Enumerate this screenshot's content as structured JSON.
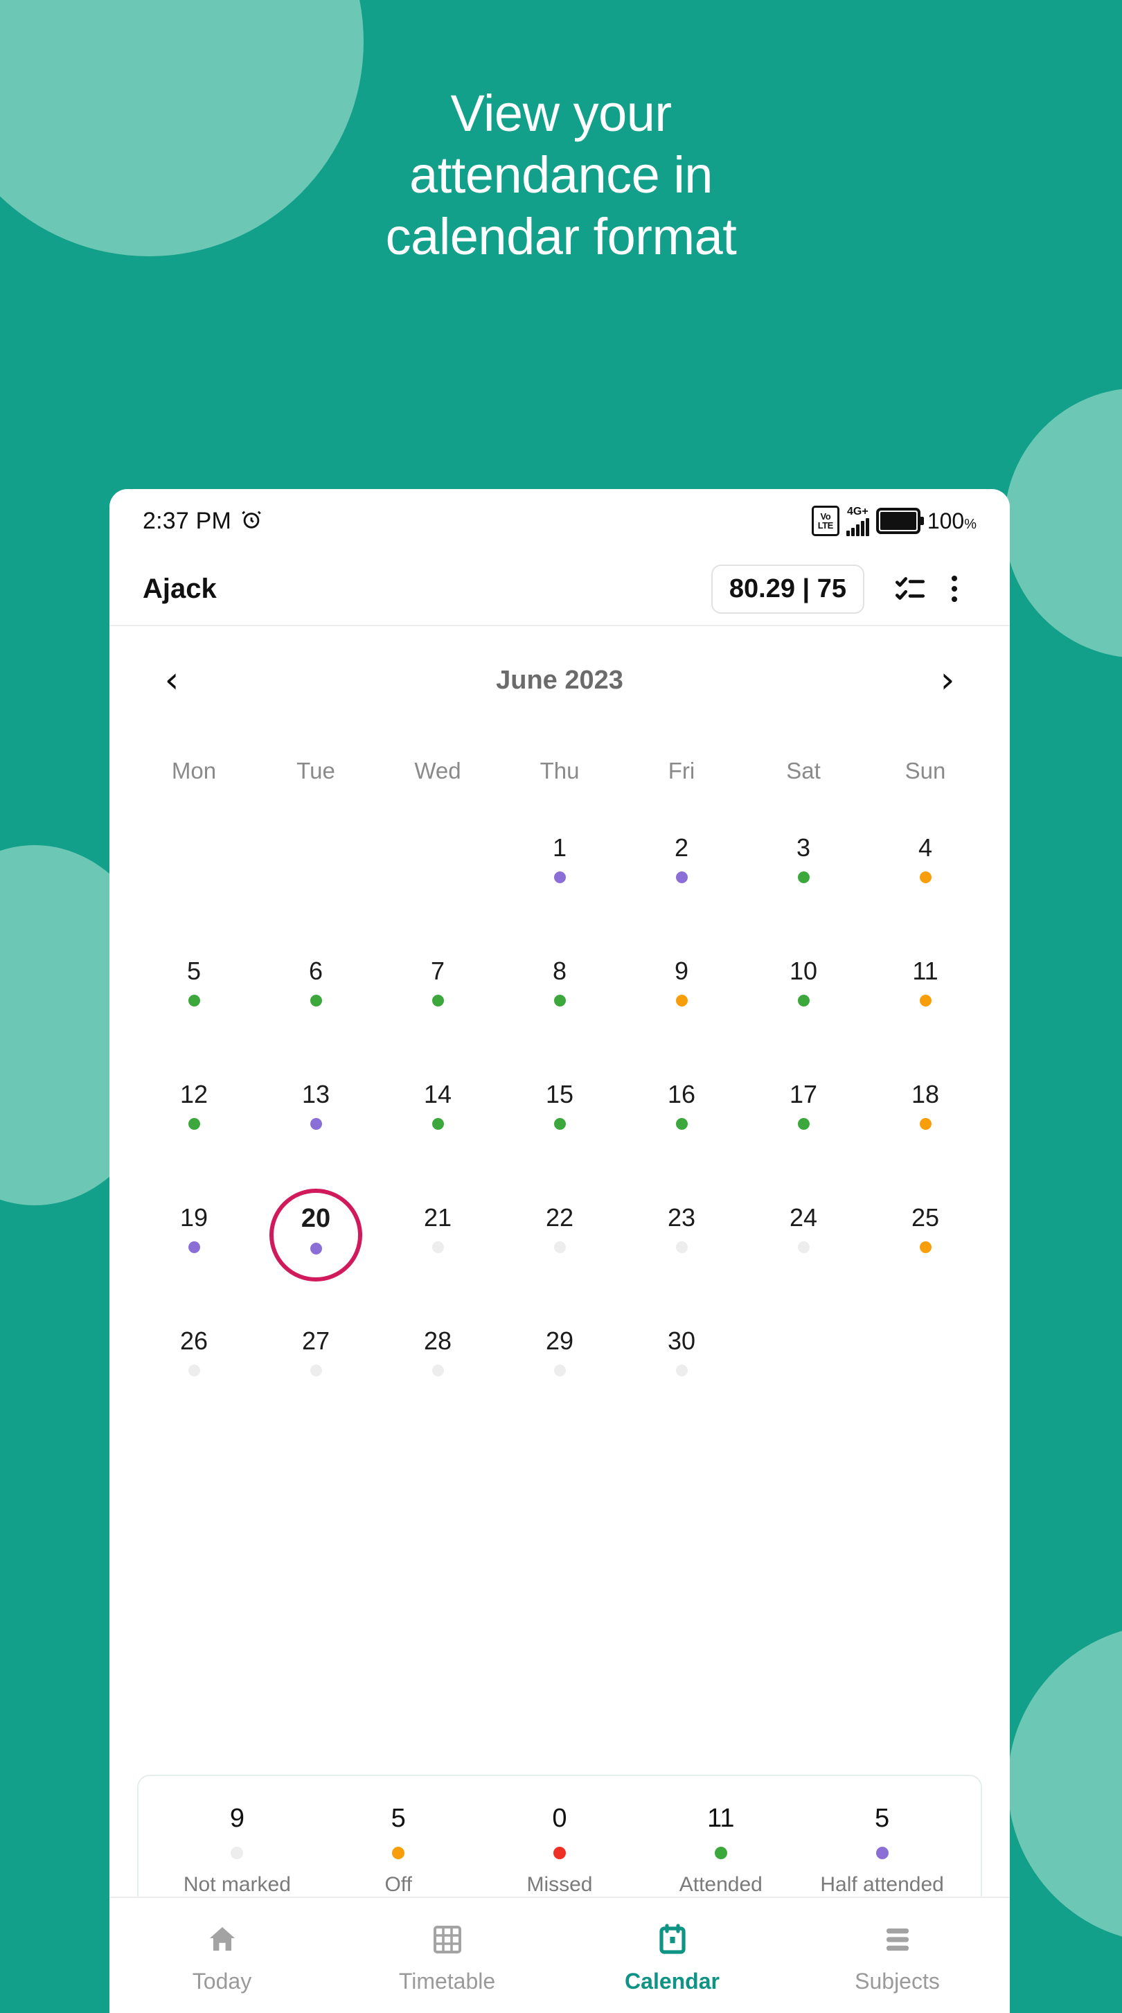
{
  "promo": {
    "headline_lines": [
      "View your",
      "attendance in",
      "calendar format"
    ],
    "background_color": "#12A08A",
    "accent_circle_color": "#6CC8B5"
  },
  "statusbar": {
    "time": "2:37 PM",
    "alarm_icon": "alarm-clock-icon",
    "volte_top": "Vo",
    "volte_bottom": "LTE",
    "network": "4G+",
    "battery_percent": "100",
    "percent_symbol": "%"
  },
  "appbar": {
    "title": "Ajack",
    "percentage_badge": "80.29 | 75",
    "checklist_icon": "checklist-icon",
    "overflow_icon": "more-vertical-icon"
  },
  "calendar": {
    "prev_label": "‹",
    "next_label": "›",
    "month_label": "June 2023",
    "weekdays": [
      "Mon",
      "Tue",
      "Wed",
      "Thu",
      "Fri",
      "Sat",
      "Sun"
    ],
    "leading_blanks": 3,
    "selected_day": "20",
    "selected_ring_color": "#D01A5B",
    "status_colors": {
      "attended": "#3CA83C",
      "half": "#8B6FD6",
      "off": "#F79E0A",
      "missed": "#EE3124",
      "not_marked": "#EDEDED"
    },
    "days": [
      {
        "num": "1",
        "status": "half"
      },
      {
        "num": "2",
        "status": "half"
      },
      {
        "num": "3",
        "status": "attended"
      },
      {
        "num": "4",
        "status": "off"
      },
      {
        "num": "5",
        "status": "attended"
      },
      {
        "num": "6",
        "status": "attended"
      },
      {
        "num": "7",
        "status": "attended"
      },
      {
        "num": "8",
        "status": "attended"
      },
      {
        "num": "9",
        "status": "off"
      },
      {
        "num": "10",
        "status": "attended"
      },
      {
        "num": "11",
        "status": "off"
      },
      {
        "num": "12",
        "status": "attended"
      },
      {
        "num": "13",
        "status": "half"
      },
      {
        "num": "14",
        "status": "attended"
      },
      {
        "num": "15",
        "status": "attended"
      },
      {
        "num": "16",
        "status": "attended"
      },
      {
        "num": "17",
        "status": "attended"
      },
      {
        "num": "18",
        "status": "off"
      },
      {
        "num": "19",
        "status": "half"
      },
      {
        "num": "20",
        "status": "half"
      },
      {
        "num": "21",
        "status": "not_marked"
      },
      {
        "num": "22",
        "status": "not_marked"
      },
      {
        "num": "23",
        "status": "not_marked"
      },
      {
        "num": "24",
        "status": "not_marked"
      },
      {
        "num": "25",
        "status": "off"
      },
      {
        "num": "26",
        "status": "not_marked"
      },
      {
        "num": "27",
        "status": "not_marked"
      },
      {
        "num": "28",
        "status": "not_marked"
      },
      {
        "num": "29",
        "status": "not_marked"
      },
      {
        "num": "30",
        "status": "not_marked"
      }
    ]
  },
  "stats": [
    {
      "value": "9",
      "label": "Not marked",
      "color": "#EDEDED"
    },
    {
      "value": "5",
      "label": "Off",
      "color": "#F79E0A"
    },
    {
      "value": "0",
      "label": "Missed",
      "color": "#EE3124"
    },
    {
      "value": "11",
      "label": "Attended",
      "color": "#3CA83C"
    },
    {
      "value": "5",
      "label": "Half attended",
      "color": "#8B6FD6"
    }
  ],
  "bottomnav": {
    "active_color": "#0E9384",
    "items": [
      {
        "label": "Today",
        "icon": "home-icon",
        "active": false
      },
      {
        "label": "Timetable",
        "icon": "grid-icon",
        "active": false
      },
      {
        "label": "Calendar",
        "icon": "calendar-icon",
        "active": true
      },
      {
        "label": "Subjects",
        "icon": "list-icon",
        "active": false
      }
    ]
  }
}
